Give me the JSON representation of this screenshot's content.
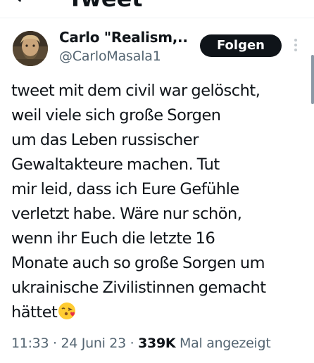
{
  "header": {
    "title": "Tweet",
    "back_icon": "back-arrow-icon"
  },
  "author": {
    "display_name": "Carlo \"Realism,...",
    "handle": "@CarloMasala1",
    "follow_label": "Folgen",
    "avatar": "avatar-photo",
    "more_icon": "more-vertical-icon"
  },
  "tweet": {
    "lines": [
      "tweet mit dem civil war gelöscht,",
      "weil viele sich große Sorgen",
      "um das Leben russischer",
      "Gewaltakteure machen. Tut",
      "mir leid, dass ich Eure Gefühle",
      "verletzt habe. Wäre nur schön,",
      "wenn ihr Euch die letzte 16",
      "Monate auch so große Sorgen um",
      "ukrainische Zivilistinnen gemacht",
      "hättet"
    ],
    "emoji": "face-blowing-kiss-emoji"
  },
  "meta": {
    "time": "11:33",
    "separator": " · ",
    "date": "24 Juni 23",
    "views": "339K",
    "views_label": " Mal angezeigt"
  }
}
